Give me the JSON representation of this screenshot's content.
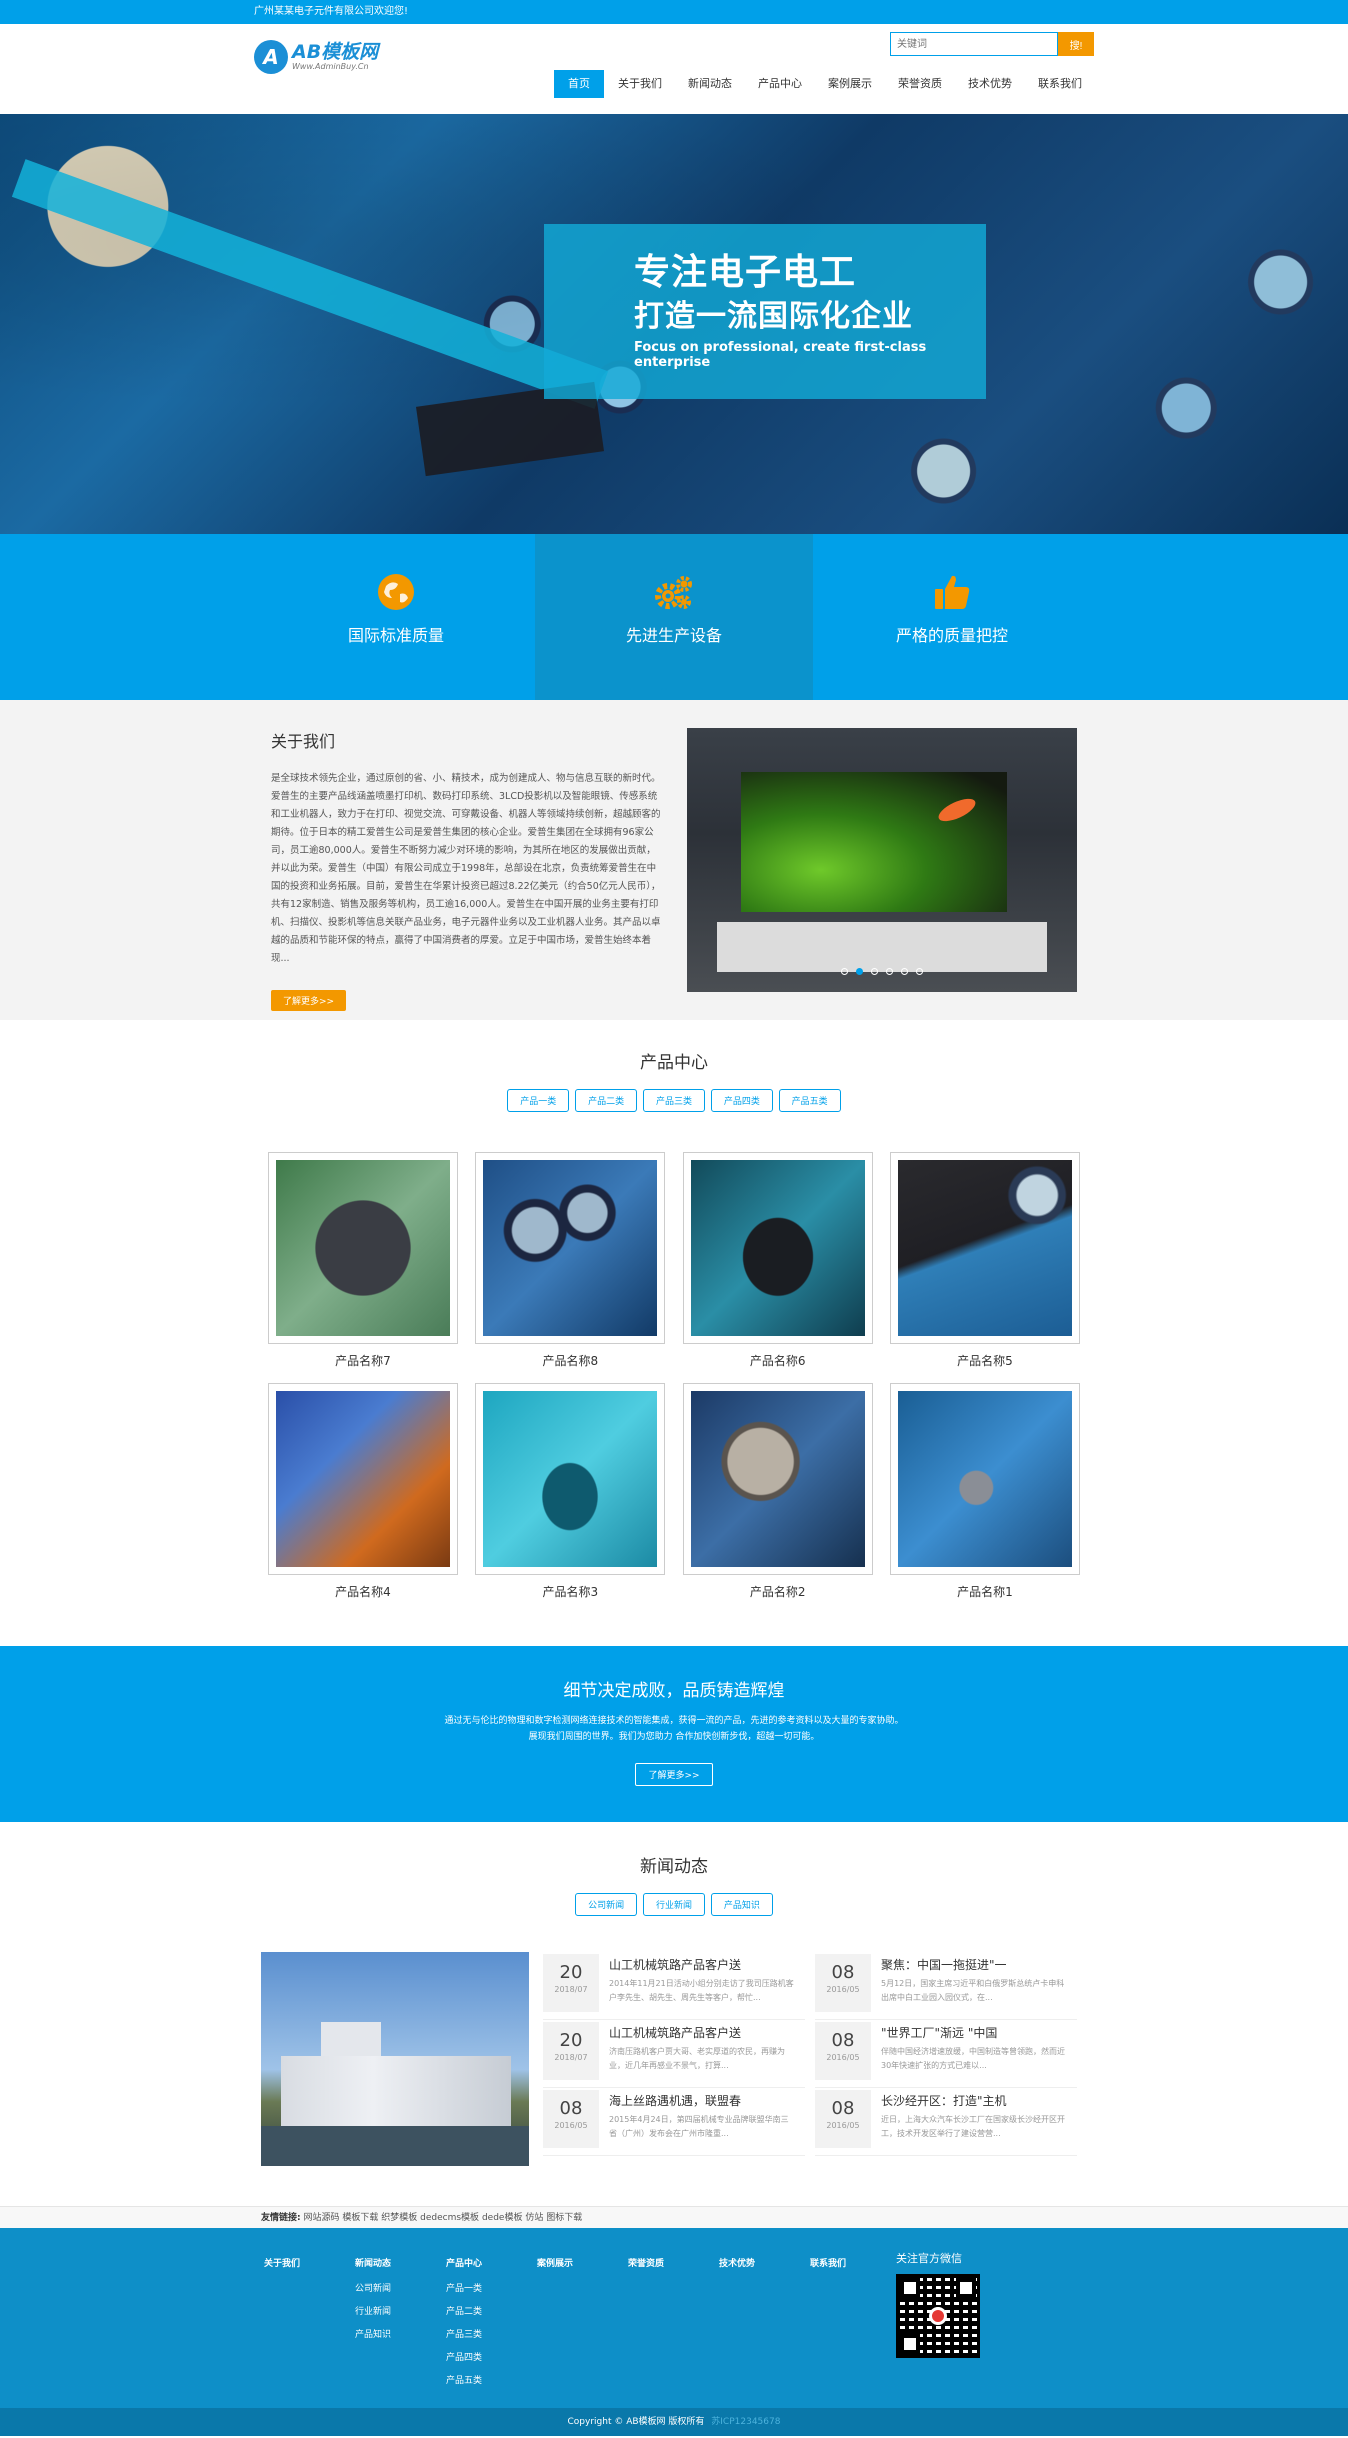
{
  "topbar": {
    "welcome": "广州某某电子元件有限公司欢迎您!"
  },
  "logo": {
    "mark": "A",
    "title": "AB模板网",
    "subtitle": "Www.AdminBuy.Cn"
  },
  "search": {
    "placeholder": "关键词",
    "button": "搜!"
  },
  "nav": [
    "首页",
    "关于我们",
    "新闻动态",
    "产品中心",
    "案例展示",
    "荣誉资质",
    "技术优势",
    "联系我们"
  ],
  "banner": {
    "line1": "专注电子电工",
    "line2": "打造一流国际化企业",
    "english": "Focus on professional, create first-class enterprise"
  },
  "features": [
    {
      "label": "国际标准质量",
      "icon": "globe-icon"
    },
    {
      "label": "先进生产设备",
      "icon": "gears-icon"
    },
    {
      "label": "严格的质量把控",
      "icon": "thumbs-up-icon"
    }
  ],
  "colors": {
    "primary": "#00a0e9",
    "accent": "#f39800",
    "footer": "#0e8fc8"
  },
  "about": {
    "title": "关于我们",
    "text": "是全球技术领先企业，通过原创的省、小、精技术，成为创建成人、物与信息互联的新时代。爱普生的主要产品线涵盖喷墨打印机、数码打印系统、3LCD投影机以及智能眼镜、传感系统和工业机器人，致力于在打印、视觉交流、可穿戴设备、机器人等领域持续创新，超越顾客的期待。位于日本的精工爱普生公司是爱普生集团的核心企业。爱普生集团在全球拥有96家公司，员工逾80,000人。爱普生不断努力减少对环境的影响，为其所在地区的发展做出贡献，并以此为荣。爱普生（中国）有限公司成立于1998年，总部设在北京，负责统筹爱普生在中国的投资和业务拓展。目前，爱普生在华累计投资已超过8.22亿美元（约合50亿元人民币），共有12家制造、销售及服务等机构，员工逾16,000人。爱普生在中国开展的业务主要有打印机、扫描仪、投影机等信息关联产品业务，电子元器件业务以及工业机器人业务。其产品以卓越的品质和节能环保的特点，赢得了中国消费者的厚爱。立足于中国市场，爱普生始终本着现...",
    "button": "了解更多>>"
  },
  "products": {
    "title": "产品中心",
    "tabs": [
      "产品一类",
      "产品二类",
      "产品三类",
      "产品四类",
      "产品五类"
    ],
    "items": [
      {
        "name": "产品名称7"
      },
      {
        "name": "产品名称8"
      },
      {
        "name": "产品名称6"
      },
      {
        "name": "产品名称5"
      },
      {
        "name": "产品名称4"
      },
      {
        "name": "产品名称3"
      },
      {
        "name": "产品名称2"
      },
      {
        "name": "产品名称1"
      }
    ]
  },
  "cta": {
    "title": "细节决定成败，品质铸造辉煌",
    "line1": "通过无与伦比的物理和数字检测网络连接技术的智能集成，获得一流的产品，先进的参考资料以及大量的专家协助。",
    "line2": "展现我们周围的世界。我们为您助力 合作加快创新步伐，超越一切可能。",
    "button": "了解更多>>"
  },
  "news": {
    "title": "新闻动态",
    "tabs": [
      "公司新闻",
      "行业新闻",
      "产品知识"
    ],
    "left": [
      {
        "day": "20",
        "ym": "2018/07",
        "title": "山工机械筑路产品客户送",
        "desc": "2014年11月21日活动小组分别走访了我司压路机客户李先生、胡先生、周先生等客户，帮忙..."
      },
      {
        "day": "20",
        "ym": "2018/07",
        "title": "山工机械筑路产品客户送",
        "desc": "济南压路机客户贾大哥、老实厚道的农民，再赚为业，近几年再感业不景气，打算..."
      },
      {
        "day": "08",
        "ym": "2016/05",
        "title": "海上丝路遇机遇，联盟春",
        "desc": "2015年4月24日，第四届机械专业品牌联盟华南三省（广州）发布会在广州市隆重..."
      }
    ],
    "right": [
      {
        "day": "08",
        "ym": "2016/05",
        "title": "聚焦：中国一拖挺进\"一",
        "desc": "5月12日，国家主席习近平和白俄罗斯总统卢卡申科出席中白工业园入园仪式，在..."
      },
      {
        "day": "08",
        "ym": "2016/05",
        "title": "\"世界工厂\"渐远 \"中国",
        "desc": "伴随中国经济增速放缓，中国制造等曾领跑，然而近30年快速扩张的方式已难以..."
      },
      {
        "day": "08",
        "ym": "2016/05",
        "title": "长沙经开区：打造\"主机",
        "desc": "近日，上海大众汽车长沙工厂在国家级长沙经开区开工，技术开发区举行了建设营营..."
      }
    ]
  },
  "links": {
    "label": "友情链接:",
    "items": [
      "网站源码",
      "模板下载",
      "织梦模板",
      "dedecms模板",
      "dede模板",
      "仿站",
      "图标下载"
    ]
  },
  "footer": {
    "columns": [
      {
        "head": "关于我们",
        "items": []
      },
      {
        "head": "新闻动态",
        "items": [
          "公司新闻",
          "行业新闻",
          "产品知识"
        ]
      },
      {
        "head": "产品中心",
        "items": [
          "产品一类",
          "产品二类",
          "产品三类",
          "产品四类",
          "产品五类"
        ]
      },
      {
        "head": "案例展示",
        "items": []
      },
      {
        "head": "荣誉资质",
        "items": []
      },
      {
        "head": "技术优势",
        "items": []
      },
      {
        "head": "联系我们",
        "items": []
      }
    ],
    "qr_title": "关注官方微信",
    "copyright": "Copyright © AB模板网 版权所有",
    "icp": "苏ICP12345678"
  }
}
